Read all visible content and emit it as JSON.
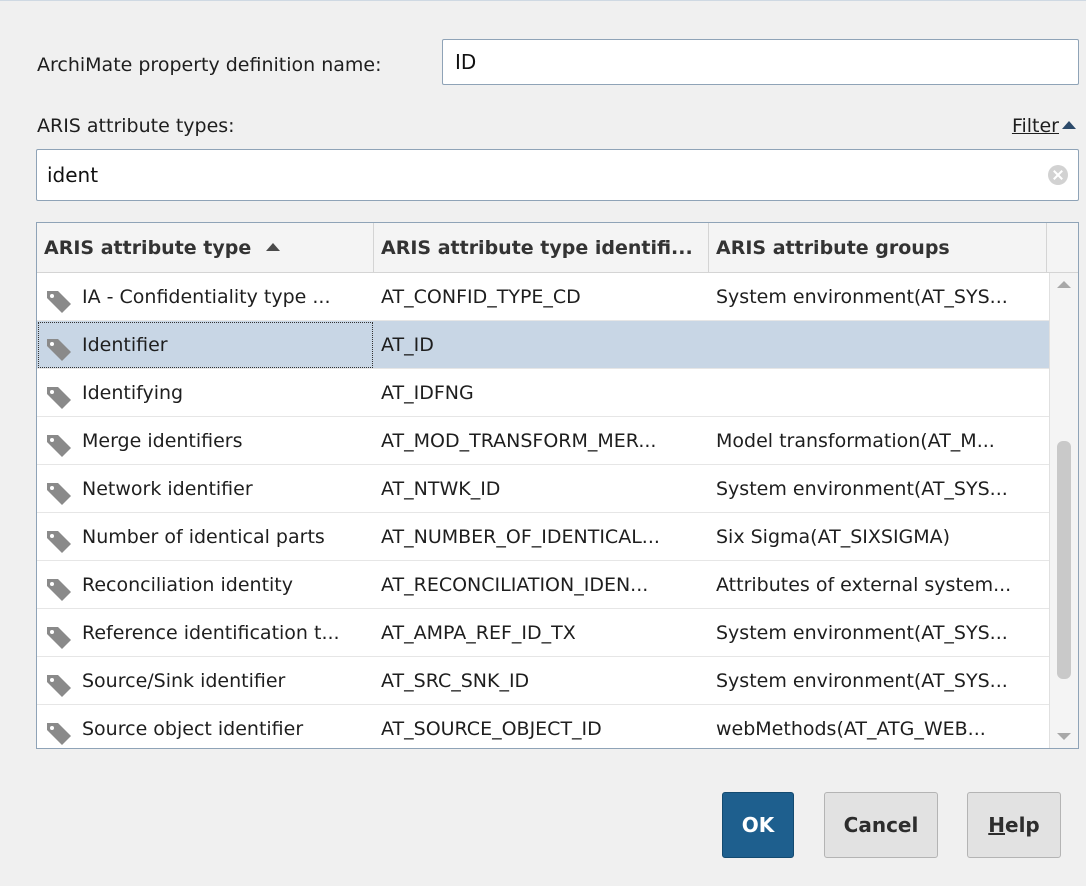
{
  "form": {
    "name_label": "ArchiMate property definition name:",
    "name_value": "ID",
    "types_label": "ARIS attribute types:",
    "filter_label": "Filter",
    "search_value": "ident"
  },
  "table": {
    "columns": [
      {
        "label": "ARIS attribute type",
        "sorted": "ascending"
      },
      {
        "label": "ARIS attribute type identifi..."
      },
      {
        "label": "ARIS attribute groups"
      }
    ],
    "rows": [
      {
        "name": "IA - Confidentiality type ...",
        "identifier": "AT_CONFID_TYPE_CD",
        "groups": "System environment(AT_SYS..."
      },
      {
        "name": "Identifier",
        "identifier": "AT_ID",
        "groups": "",
        "selected": true
      },
      {
        "name": "Identifying",
        "identifier": "AT_IDFNG",
        "groups": ""
      },
      {
        "name": "Merge identifiers",
        "identifier": "AT_MOD_TRANSFORM_MER...",
        "groups": "Model transformation(AT_M..."
      },
      {
        "name": "Network identifier",
        "identifier": "AT_NTWK_ID",
        "groups": "System environment(AT_SYS..."
      },
      {
        "name": "Number of identical parts",
        "identifier": "AT_NUMBER_OF_IDENTICAL...",
        "groups": "Six Sigma(AT_SIXSIGMA)"
      },
      {
        "name": "Reconciliation identity",
        "identifier": "AT_RECONCILIATION_IDEN...",
        "groups": "Attributes of external system..."
      },
      {
        "name": "Reference identification t...",
        "identifier": "AT_AMPA_REF_ID_TX",
        "groups": "System environment(AT_SYS..."
      },
      {
        "name": "Source/Sink identifier",
        "identifier": "AT_SRC_SNK_ID",
        "groups": "System environment(AT_SYS..."
      },
      {
        "name": "Source object identifier",
        "identifier": "AT_SOURCE_OBJECT_ID",
        "groups": "webMethods(AT_ATG_WEB..."
      }
    ]
  },
  "buttons": {
    "ok": "OK",
    "cancel": "Cancel",
    "help_mnemonic": "H",
    "help_rest": "elp"
  },
  "icons": {
    "row_icon": "tag-icon",
    "clear_icon": "clear-icon",
    "sort_icon": "sort-ascending-icon"
  },
  "colors": {
    "accent": "#1e5f8e",
    "selection": "#c8d6e5",
    "tag_icon": "#8a8a8a"
  }
}
